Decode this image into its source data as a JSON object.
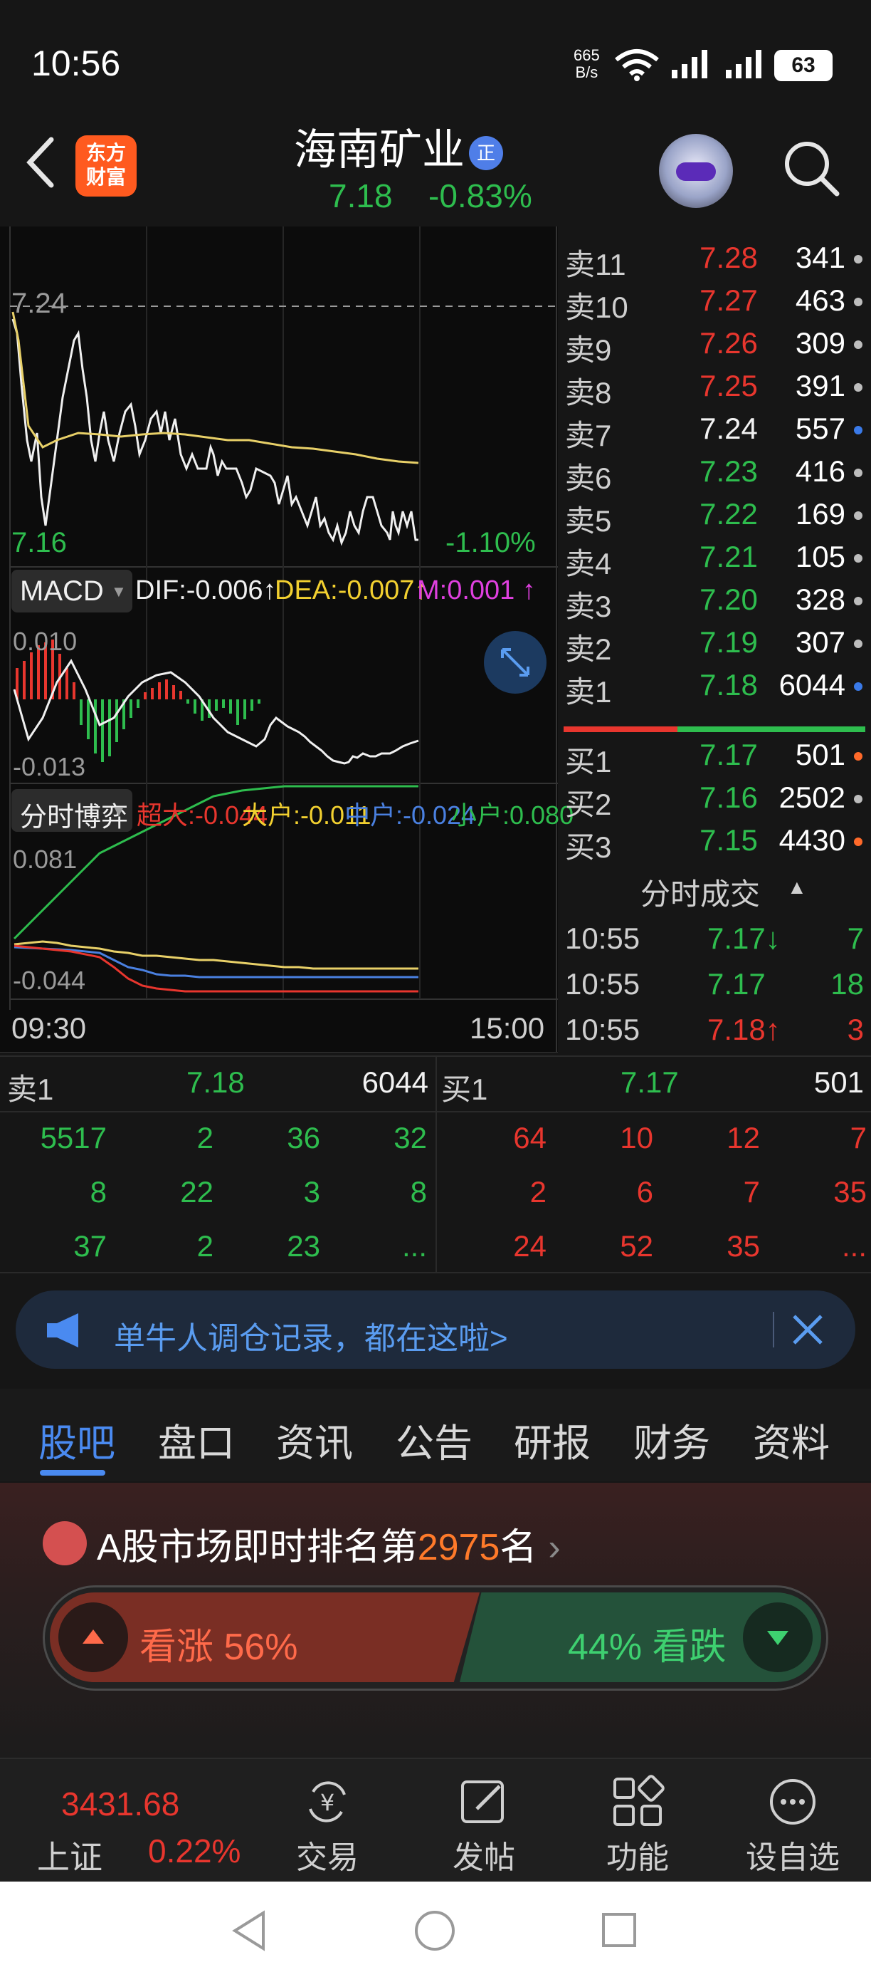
{
  "status_bar": {
    "time": "10:56",
    "net_speed_top": "665",
    "net_speed_bottom": "B/s",
    "battery": "63"
  },
  "header": {
    "logo_line1": "东方",
    "logo_line2": "财富",
    "stock_name": "海南矿业",
    "badge": "正",
    "price": "7.18",
    "change_pct": "-0.83%"
  },
  "intraday_chart": {
    "price_high_label": "7.24",
    "price_low_label": "7.16",
    "low_pct_label": "-1.10%",
    "time_start": "09:30",
    "time_end": "15:00"
  },
  "macd": {
    "name": "MACD",
    "dif": "DIF:-0.006↑",
    "dea": "DEA:-0.007↑",
    "m": "M:0.001 ↑",
    "top_label": "0.010",
    "bottom_label": "-0.013"
  },
  "fund_flow": {
    "name": "分时博弈",
    "super": "超大:-0.044",
    "large": "大户:-0.011",
    "mid": "中户:-0.024",
    "small": "小户:0.080",
    "top_label": "0.081",
    "bottom_label": "-0.044"
  },
  "order_book": {
    "asks": [
      {
        "label": "卖11",
        "price": "7.28",
        "volume": "341",
        "price_color": "red",
        "dot": "#bdbdbd"
      },
      {
        "label": "卖10",
        "price": "7.27",
        "volume": "463",
        "price_color": "red",
        "dot": "#bdbdbd"
      },
      {
        "label": "卖9",
        "price": "7.26",
        "volume": "309",
        "price_color": "red",
        "dot": "#bdbdbd"
      },
      {
        "label": "卖8",
        "price": "7.25",
        "volume": "391",
        "price_color": "red",
        "dot": "#bdbdbd"
      },
      {
        "label": "卖7",
        "price": "7.24",
        "volume": "557",
        "price_color": "white",
        "dot": "#3a7ae8"
      },
      {
        "label": "卖6",
        "price": "7.23",
        "volume": "416",
        "price_color": "green",
        "dot": "#bdbdbd"
      },
      {
        "label": "卖5",
        "price": "7.22",
        "volume": "169",
        "price_color": "green",
        "dot": "#bdbdbd"
      },
      {
        "label": "卖4",
        "price": "7.21",
        "volume": "105",
        "price_color": "green",
        "dot": "#bdbdbd"
      },
      {
        "label": "卖3",
        "price": "7.20",
        "volume": "328",
        "price_color": "green",
        "dot": "#bdbdbd"
      },
      {
        "label": "卖2",
        "price": "7.19",
        "volume": "307",
        "price_color": "green",
        "dot": "#bdbdbd"
      },
      {
        "label": "卖1",
        "price": "7.18",
        "volume": "6044",
        "price_color": "green",
        "dot": "#3a7ae8"
      }
    ],
    "bids": [
      {
        "label": "买1",
        "price": "7.17",
        "volume": "501",
        "price_color": "green",
        "dot": "#ff6a2a"
      },
      {
        "label": "买2",
        "price": "7.16",
        "volume": "2502",
        "price_color": "green",
        "dot": "#bdbdbd"
      },
      {
        "label": "买3",
        "price": "7.15",
        "volume": "4430",
        "price_color": "green",
        "dot": "#ff6a2a"
      }
    ],
    "trades_title": "分时成交",
    "trades": [
      {
        "time": "10:55",
        "price": "7.17↓",
        "volume": "7",
        "color": "green"
      },
      {
        "time": "10:55",
        "price": "7.17",
        "volume": "18",
        "color": "green"
      },
      {
        "time": "10:55",
        "price": "7.18↑",
        "volume": "3",
        "color": "red"
      }
    ]
  },
  "depth": {
    "ask_label": "卖1",
    "ask_price": "7.18",
    "ask_volume": "6044",
    "bid_label": "买1",
    "bid_price": "7.17",
    "bid_volume": "501",
    "ask_queue": [
      [
        "5517",
        "2",
        "36",
        "32"
      ],
      [
        "8",
        "22",
        "3",
        "8"
      ],
      [
        "37",
        "2",
        "23",
        "..."
      ]
    ],
    "bid_queue": [
      [
        "64",
        "10",
        "12",
        "7"
      ],
      [
        "2",
        "6",
        "7",
        "35"
      ],
      [
        "24",
        "52",
        "35",
        "..."
      ]
    ]
  },
  "banner": {
    "text": "单牛人调仓记录，都在这啦>"
  },
  "tabs": [
    "股吧",
    "盘口",
    "资讯",
    "公告",
    "研报",
    "财务",
    "资料"
  ],
  "rank": {
    "prefix": "A股市场即时排名第",
    "number": "2975",
    "suffix": "名"
  },
  "sentiment": {
    "bull": "看涨 56%",
    "bear": "44% 看跌"
  },
  "bottom_nav": {
    "index_value": "3431.68",
    "index_name": "上证",
    "index_change": "0.22%",
    "items": [
      "交易",
      "发帖",
      "功能",
      "设自选"
    ]
  }
}
